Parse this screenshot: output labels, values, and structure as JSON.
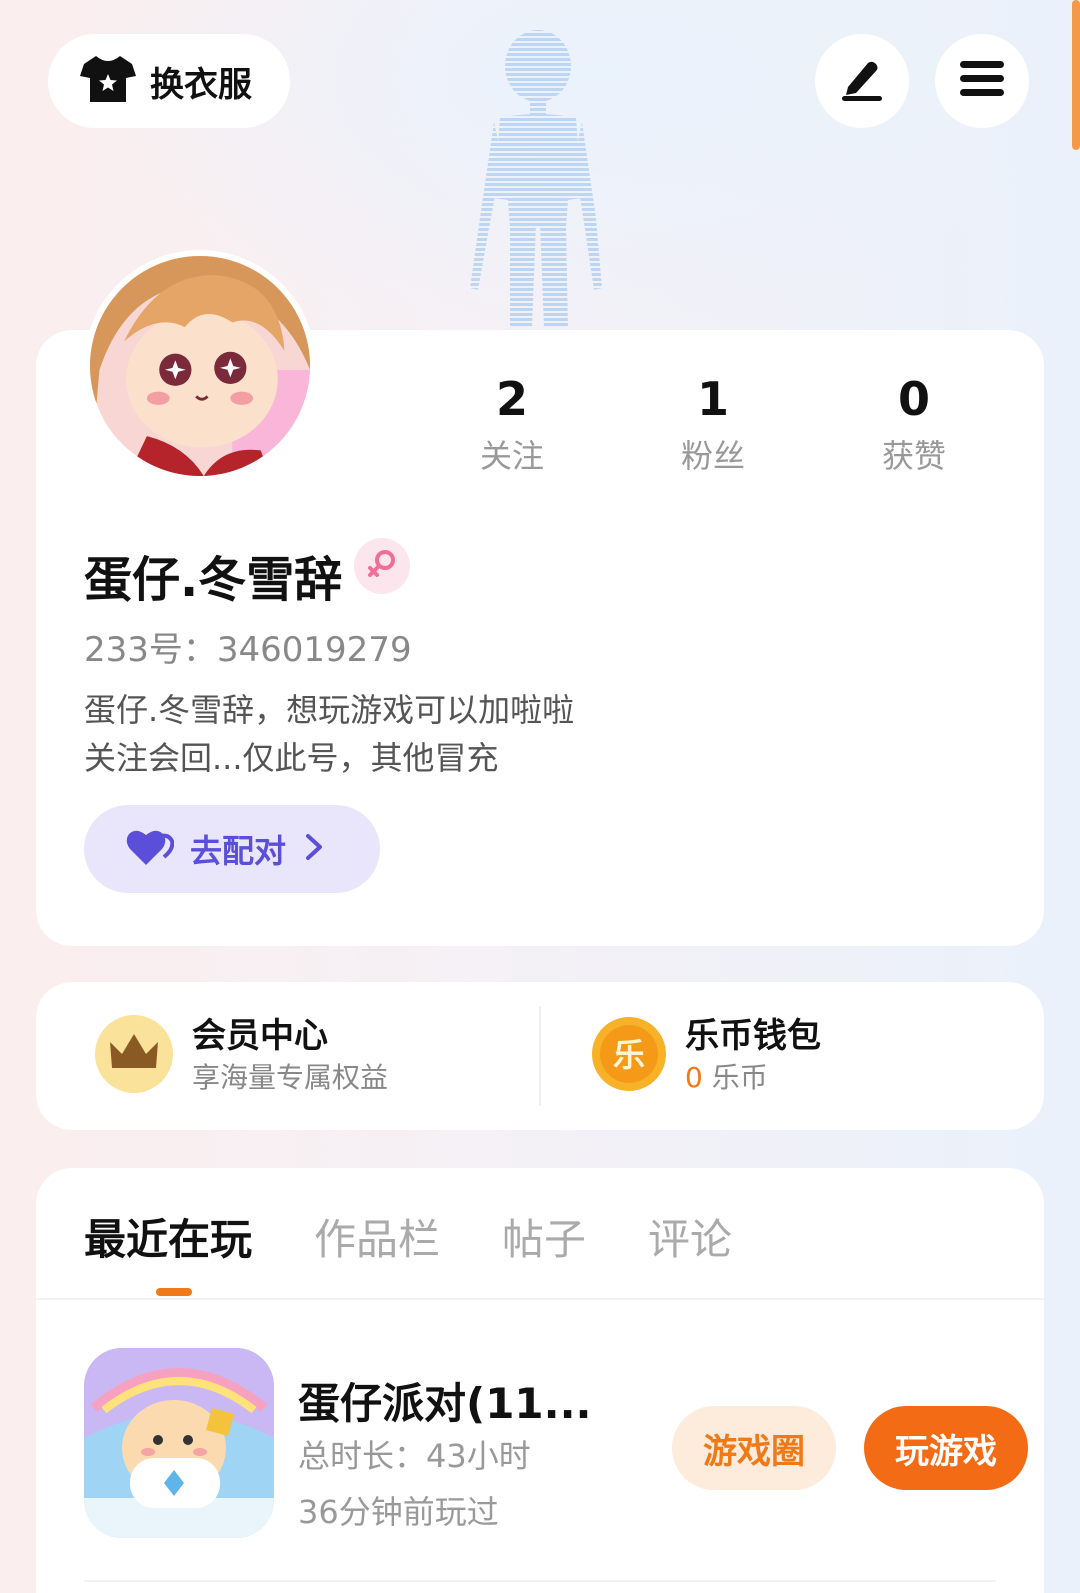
{
  "header": {
    "outfit_label": "换衣服",
    "edit_icon": "edit-icon",
    "menu_icon": "menu-icon"
  },
  "profile": {
    "stats": [
      {
        "value": "2",
        "label": "关注"
      },
      {
        "value": "1",
        "label": "粉丝"
      },
      {
        "value": "0",
        "label": "获赞"
      }
    ],
    "nickname": "蛋仔.冬雪辞",
    "gender": "female",
    "uid": "233号：346019279",
    "bio_line1": "蛋仔.冬雪辞，想玩游戏可以加啦啦",
    "bio_line2": "关注会回...仅此号，其他冒充",
    "match_label": "去配对"
  },
  "member": {
    "title": "会员中心",
    "subtitle": "享海量专属权益"
  },
  "wallet": {
    "title": "乐币钱包",
    "coin_icon_text": "乐",
    "amount": "0",
    "unit": "乐币"
  },
  "tabs": [
    {
      "label": "最近在玩",
      "active": true
    },
    {
      "label": "作品栏",
      "active": false
    },
    {
      "label": "帖子",
      "active": false
    },
    {
      "label": "评论",
      "active": false
    }
  ],
  "recent_game": {
    "title": "蛋仔派对(11...",
    "total_time": "总时长：43小时",
    "last_played": "36分钟前玩过",
    "circle_label": "游戏圈",
    "play_label": "玩游戏"
  },
  "colors": {
    "accent": "#f07a17",
    "match": "#5b4fd9"
  }
}
